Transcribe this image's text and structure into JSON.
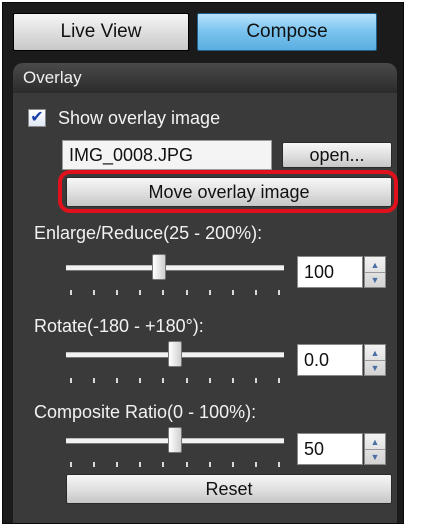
{
  "tabs": {
    "live_view": "Live View",
    "compose": "Compose"
  },
  "overlay": {
    "header": "Overlay",
    "show_overlay_label": "Show overlay image",
    "show_overlay_checked": true,
    "filename": "IMG_0008.JPG",
    "open_label": "open...",
    "move_label": "Move overlay image"
  },
  "sliders": {
    "enlarge": {
      "label": "Enlarge/Reduce(25 - 200%):",
      "value": "100",
      "min": 25,
      "max": 200
    },
    "rotate": {
      "label": "Rotate(-180 - +180°):",
      "value": "0.0",
      "min": -180,
      "max": 180
    },
    "composite": {
      "label": "Composite Ratio(0 - 100%):",
      "value": "50",
      "min": 0,
      "max": 100
    }
  },
  "reset_label": "Reset",
  "colors": {
    "highlight": "#e0111d",
    "active_tab": "#78c2ee"
  },
  "icons": {
    "checkbox": "checkmark-icon",
    "spin_up": "spin-up-arrow-icon",
    "spin_down": "spin-down-arrow-icon"
  }
}
